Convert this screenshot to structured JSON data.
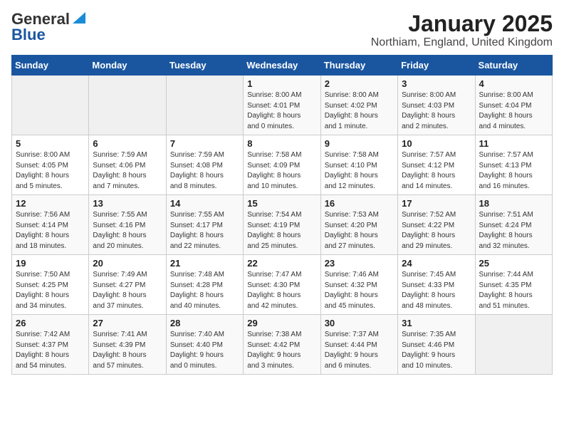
{
  "header": {
    "logo_general": "General",
    "logo_blue": "Blue",
    "title": "January 2025",
    "subtitle": "Northiam, England, United Kingdom"
  },
  "weekdays": [
    "Sunday",
    "Monday",
    "Tuesday",
    "Wednesday",
    "Thursday",
    "Friday",
    "Saturday"
  ],
  "weeks": [
    [
      {
        "day": "",
        "info": ""
      },
      {
        "day": "",
        "info": ""
      },
      {
        "day": "",
        "info": ""
      },
      {
        "day": "1",
        "info": "Sunrise: 8:00 AM\nSunset: 4:01 PM\nDaylight: 8 hours\nand 0 minutes."
      },
      {
        "day": "2",
        "info": "Sunrise: 8:00 AM\nSunset: 4:02 PM\nDaylight: 8 hours\nand 1 minute."
      },
      {
        "day": "3",
        "info": "Sunrise: 8:00 AM\nSunset: 4:03 PM\nDaylight: 8 hours\nand 2 minutes."
      },
      {
        "day": "4",
        "info": "Sunrise: 8:00 AM\nSunset: 4:04 PM\nDaylight: 8 hours\nand 4 minutes."
      }
    ],
    [
      {
        "day": "5",
        "info": "Sunrise: 8:00 AM\nSunset: 4:05 PM\nDaylight: 8 hours\nand 5 minutes."
      },
      {
        "day": "6",
        "info": "Sunrise: 7:59 AM\nSunset: 4:06 PM\nDaylight: 8 hours\nand 7 minutes."
      },
      {
        "day": "7",
        "info": "Sunrise: 7:59 AM\nSunset: 4:08 PM\nDaylight: 8 hours\nand 8 minutes."
      },
      {
        "day": "8",
        "info": "Sunrise: 7:58 AM\nSunset: 4:09 PM\nDaylight: 8 hours\nand 10 minutes."
      },
      {
        "day": "9",
        "info": "Sunrise: 7:58 AM\nSunset: 4:10 PM\nDaylight: 8 hours\nand 12 minutes."
      },
      {
        "day": "10",
        "info": "Sunrise: 7:57 AM\nSunset: 4:12 PM\nDaylight: 8 hours\nand 14 minutes."
      },
      {
        "day": "11",
        "info": "Sunrise: 7:57 AM\nSunset: 4:13 PM\nDaylight: 8 hours\nand 16 minutes."
      }
    ],
    [
      {
        "day": "12",
        "info": "Sunrise: 7:56 AM\nSunset: 4:14 PM\nDaylight: 8 hours\nand 18 minutes."
      },
      {
        "day": "13",
        "info": "Sunrise: 7:55 AM\nSunset: 4:16 PM\nDaylight: 8 hours\nand 20 minutes."
      },
      {
        "day": "14",
        "info": "Sunrise: 7:55 AM\nSunset: 4:17 PM\nDaylight: 8 hours\nand 22 minutes."
      },
      {
        "day": "15",
        "info": "Sunrise: 7:54 AM\nSunset: 4:19 PM\nDaylight: 8 hours\nand 25 minutes."
      },
      {
        "day": "16",
        "info": "Sunrise: 7:53 AM\nSunset: 4:20 PM\nDaylight: 8 hours\nand 27 minutes."
      },
      {
        "day": "17",
        "info": "Sunrise: 7:52 AM\nSunset: 4:22 PM\nDaylight: 8 hours\nand 29 minutes."
      },
      {
        "day": "18",
        "info": "Sunrise: 7:51 AM\nSunset: 4:24 PM\nDaylight: 8 hours\nand 32 minutes."
      }
    ],
    [
      {
        "day": "19",
        "info": "Sunrise: 7:50 AM\nSunset: 4:25 PM\nDaylight: 8 hours\nand 34 minutes."
      },
      {
        "day": "20",
        "info": "Sunrise: 7:49 AM\nSunset: 4:27 PM\nDaylight: 8 hours\nand 37 minutes."
      },
      {
        "day": "21",
        "info": "Sunrise: 7:48 AM\nSunset: 4:28 PM\nDaylight: 8 hours\nand 40 minutes."
      },
      {
        "day": "22",
        "info": "Sunrise: 7:47 AM\nSunset: 4:30 PM\nDaylight: 8 hours\nand 42 minutes."
      },
      {
        "day": "23",
        "info": "Sunrise: 7:46 AM\nSunset: 4:32 PM\nDaylight: 8 hours\nand 45 minutes."
      },
      {
        "day": "24",
        "info": "Sunrise: 7:45 AM\nSunset: 4:33 PM\nDaylight: 8 hours\nand 48 minutes."
      },
      {
        "day": "25",
        "info": "Sunrise: 7:44 AM\nSunset: 4:35 PM\nDaylight: 8 hours\nand 51 minutes."
      }
    ],
    [
      {
        "day": "26",
        "info": "Sunrise: 7:42 AM\nSunset: 4:37 PM\nDaylight: 8 hours\nand 54 minutes."
      },
      {
        "day": "27",
        "info": "Sunrise: 7:41 AM\nSunset: 4:39 PM\nDaylight: 8 hours\nand 57 minutes."
      },
      {
        "day": "28",
        "info": "Sunrise: 7:40 AM\nSunset: 4:40 PM\nDaylight: 9 hours\nand 0 minutes."
      },
      {
        "day": "29",
        "info": "Sunrise: 7:38 AM\nSunset: 4:42 PM\nDaylight: 9 hours\nand 3 minutes."
      },
      {
        "day": "30",
        "info": "Sunrise: 7:37 AM\nSunset: 4:44 PM\nDaylight: 9 hours\nand 6 minutes."
      },
      {
        "day": "31",
        "info": "Sunrise: 7:35 AM\nSunset: 4:46 PM\nDaylight: 9 hours\nand 10 minutes."
      },
      {
        "day": "",
        "info": ""
      }
    ]
  ]
}
